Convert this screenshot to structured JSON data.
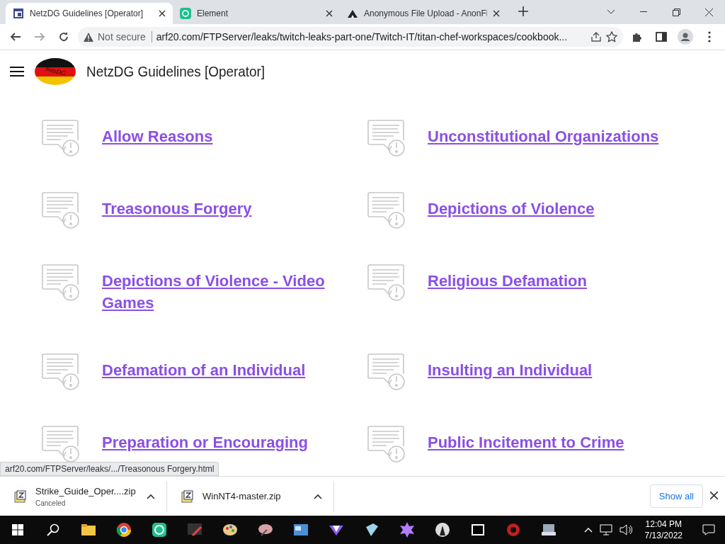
{
  "browser": {
    "tabs": [
      {
        "title": "NetzDG Guidelines [Operator]",
        "selected": true
      },
      {
        "title": "Element",
        "selected": false
      },
      {
        "title": "Anonymous File Upload - AnonFi",
        "selected": false
      }
    ],
    "address_bar": {
      "security": "Not secure",
      "url": "arf20.com/FTPServer/leaks/twitch-leaks-part-one/Twitch-IT/titan-chef-workspaces/cookbook..."
    }
  },
  "page": {
    "title": "NetzDG Guidelines [Operator]",
    "logo_text": "NetzDG",
    "items": [
      {
        "label": "Allow Reasons"
      },
      {
        "label": "Unconstitutional Organizations"
      },
      {
        "label": "Treasonous Forgery"
      },
      {
        "label": "Depictions of Violence"
      },
      {
        "label": "Depictions of Violence - Video Games"
      },
      {
        "label": "Religious Defamation"
      },
      {
        "label": "Defamation of an Individual"
      },
      {
        "label": "Insulting an Individual"
      },
      {
        "label": "Preparation or Encouraging"
      },
      {
        "label": "Public Incitement to Crime"
      }
    ]
  },
  "status_url": "arf20.com/FTPServer/leaks/.../Treasonous Forgery.html",
  "downloads": [
    {
      "name": "Strike_Guide_Oper....zip",
      "status": "Canceled"
    },
    {
      "name": "WinNT4-master.zip"
    }
  ],
  "show_all": "Show all",
  "taskbar": {
    "time": "12:04 PM",
    "date": "7/13/2022"
  }
}
